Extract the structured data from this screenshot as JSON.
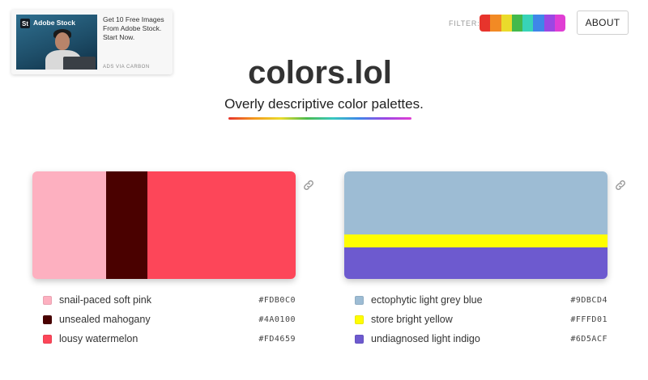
{
  "ad": {
    "logo_mark": "St",
    "brand": "Adobe Stock",
    "text": "Get 10 Free Images From Adobe Stock. Start Now.",
    "via": "ADS VIA CARBON"
  },
  "filter": {
    "label": "FILTER:",
    "colors": [
      "#e7342c",
      "#f28a24",
      "#eadb2b",
      "#43b94c",
      "#38d3b8",
      "#3f86e8",
      "#9b47e3",
      "#e03ed4"
    ]
  },
  "about_label": "ABOUT",
  "title": "colors.lol",
  "subtitle": "Overly descriptive color palettes.",
  "palettes": [
    {
      "layout": "horizontal",
      "colors": [
        {
          "name": "snail-paced soft pink",
          "hex": "#FDB0C0",
          "weight": 91
        },
        {
          "name": "unsealed mahogany",
          "hex": "#4A0100",
          "weight": 51
        },
        {
          "name": "lousy watermelon",
          "hex": "#FD4659",
          "weight": 183
        }
      ]
    },
    {
      "layout": "vertical",
      "colors": [
        {
          "name": "ectophytic light grey blue",
          "hex": "#9DBCD4",
          "weight": 78
        },
        {
          "name": "store bright yellow",
          "hex": "#FFFD01",
          "weight": 16
        },
        {
          "name": "undiagnosed light indigo",
          "hex": "#6D5ACF",
          "weight": 39
        }
      ]
    }
  ]
}
